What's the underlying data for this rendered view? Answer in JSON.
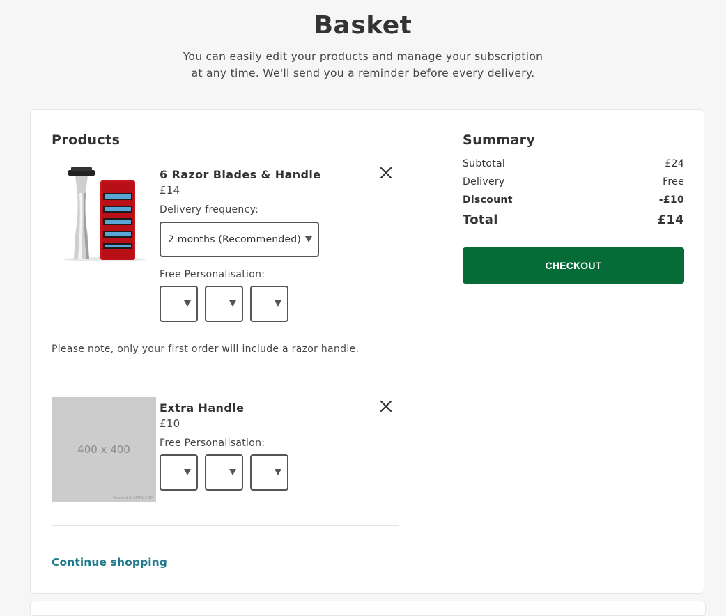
{
  "page": {
    "title": "Basket",
    "subtitle_line1": "You can easily edit your products and manage your subscription",
    "subtitle_line2": "at any time. We'll send you a reminder before every delivery."
  },
  "products": {
    "heading": "Products",
    "items": [
      {
        "name": "6 Razor Blades & Handle",
        "price": "£14",
        "delivery_frequency_label": "Delivery frequency:",
        "delivery_frequency_value": "2 months (Recommended)",
        "personalisation_label": "Free Personalisation:",
        "personalisation_values": [
          "",
          "",
          ""
        ],
        "image": "razor-with-blades"
      },
      {
        "name": "Extra Handle",
        "price": "£10",
        "personalisation_label": "Free Personalisation:",
        "personalisation_values": [
          "",
          "",
          ""
        ],
        "image_placeholder_text": "400 x 400",
        "image_placeholder_credit": "Powered by HTML.COM"
      }
    ],
    "note": "Please note, only your first order will include a razor handle.",
    "continue_label": "Continue shopping"
  },
  "summary": {
    "heading": "Summary",
    "subtotal_label": "Subtotal",
    "subtotal_value": "£24",
    "delivery_label": "Delivery",
    "delivery_value": "Free",
    "discount_label": "Discount",
    "discount_value": "-£10",
    "total_label": "Total",
    "total_value": "£14",
    "checkout_label": "CHECKOUT"
  },
  "colors": {
    "accent_green": "#056b37",
    "link_teal": "#1f7a8c",
    "background": "#f6f6f6"
  }
}
